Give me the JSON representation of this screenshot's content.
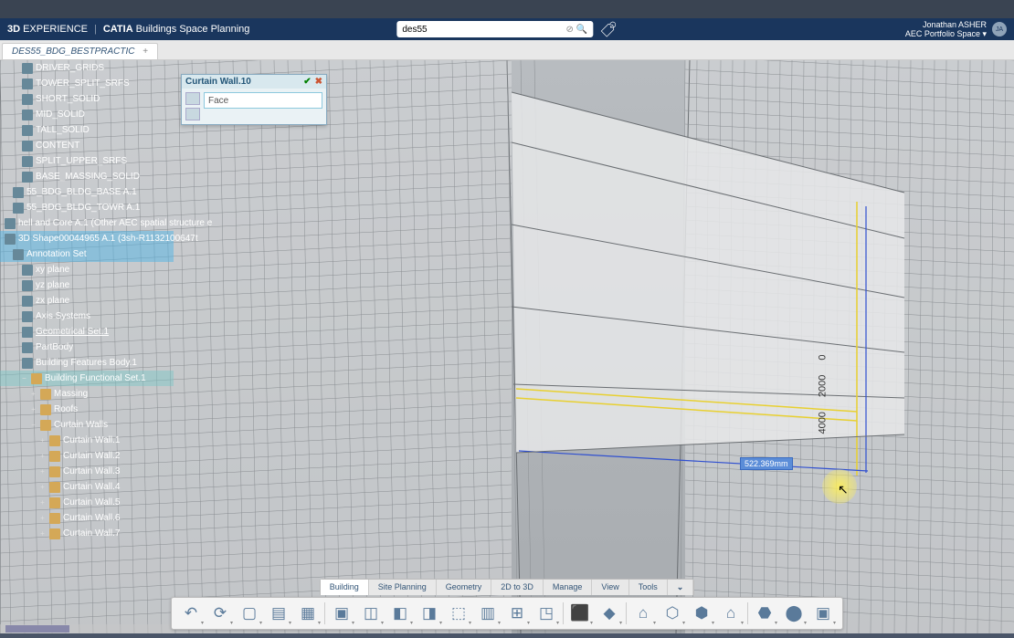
{
  "header": {
    "brand_prefix": "3D",
    "brand_main": "EXPERIENCE",
    "brand_product": "CATIA",
    "module": "Buildings Space Planning",
    "search_value": "des55",
    "user_name": "Jonathan ASHER",
    "user_space": "AEC Portfolio Space",
    "avatar_initials": "JA"
  },
  "tab": {
    "name": "DES55_BDG_BESTPRACTIC",
    "close": "+"
  },
  "tree": [
    {
      "label": "DRIVER_GRIDS",
      "indent": 1,
      "icon": "g"
    },
    {
      "label": "TOWER_SPLIT_SRFS",
      "indent": 1,
      "icon": "g"
    },
    {
      "label": "SHORT_SOLID",
      "indent": 1,
      "icon": "g"
    },
    {
      "label": "MID_SOLID",
      "indent": 1,
      "icon": "g"
    },
    {
      "label": "TALL_SOLID",
      "indent": 1,
      "icon": "g"
    },
    {
      "label": "CONTENT",
      "indent": 1,
      "icon": "g"
    },
    {
      "label": "SPLIT_UPPER_SRFS",
      "indent": 1,
      "icon": "g"
    },
    {
      "label": "BASE_MASSING_SOLID",
      "indent": 1,
      "icon": "g"
    },
    {
      "label": "55_BDG_BLDG_BASE A.1",
      "indent": 0,
      "icon": "g"
    },
    {
      "label": "55_BDG_BLDG_TOWR A.1",
      "indent": 0,
      "icon": "g"
    },
    {
      "label": "hell and Core A.1 (Other AEC spatial structure e",
      "indent": 0,
      "icon": "g"
    },
    {
      "label": "3D Shape00044965 A.1 (3sh-R1132100647t",
      "indent": 0,
      "icon": "g",
      "sel": true
    },
    {
      "label": "Annotation Set",
      "indent": 0,
      "icon": "g",
      "sel": true
    },
    {
      "label": "xy plane",
      "indent": 1,
      "icon": "g"
    },
    {
      "label": "yz plane",
      "indent": 1,
      "icon": "g"
    },
    {
      "label": "zx plane",
      "indent": 1,
      "icon": "g"
    },
    {
      "label": "Axis Systems",
      "indent": 1,
      "icon": "g"
    },
    {
      "label": "Geometrical Set.1",
      "indent": 1,
      "icon": "g",
      "u": true
    },
    {
      "label": "PartBody",
      "indent": 1,
      "icon": "g"
    },
    {
      "label": "Building Features Body.1",
      "indent": 1,
      "icon": "g"
    },
    {
      "label": "Building Functional Set.1",
      "indent": 2,
      "icon": "f",
      "hl": true,
      "exp": "−"
    },
    {
      "label": "Massing",
      "indent": 3,
      "icon": "f",
      "exp": "+"
    },
    {
      "label": "Roofs",
      "indent": 3,
      "icon": "f",
      "exp": "+"
    },
    {
      "label": "Curtain Walls",
      "indent": 3,
      "icon": "f",
      "exp": "−"
    },
    {
      "label": "Curtain Wall.1",
      "indent": 4,
      "icon": "f",
      "exp": "+"
    },
    {
      "label": "Curtain Wall.2",
      "indent": 4,
      "icon": "f",
      "exp": "+"
    },
    {
      "label": "Curtain Wall.3",
      "indent": 4,
      "icon": "f",
      "exp": "+"
    },
    {
      "label": "Curtain Wall.4",
      "indent": 4,
      "icon": "f",
      "exp": "+"
    },
    {
      "label": "Curtain Wall.5",
      "indent": 4,
      "icon": "f",
      "exp": "+"
    },
    {
      "label": "Curtain Wall.6",
      "indent": 4,
      "icon": "f",
      "exp": "+"
    },
    {
      "label": "Curtain Wall.7",
      "indent": 4,
      "icon": "f",
      "exp": "+"
    }
  ],
  "dialog": {
    "title": "Curtain Wall.10",
    "field_value": "Face"
  },
  "measurement": "522.369mm",
  "dims": {
    "a": "4000",
    "b": "2000",
    "c": "0"
  },
  "action_tabs": [
    "Building",
    "Site Planning",
    "Geometry",
    "2D to 3D",
    "Manage",
    "View",
    "Tools"
  ],
  "toolbar_icons": [
    "↶",
    "⟳",
    "▢",
    "▤",
    "▦",
    "|",
    "▣",
    "◫",
    "◧",
    "◨",
    "⬚",
    "▥",
    "⊞",
    "◳",
    "|",
    "⬛",
    "◆",
    "|",
    "⌂",
    "⬡",
    "⬢",
    "⌂",
    "|",
    "⬣",
    "⬤",
    "▣"
  ]
}
